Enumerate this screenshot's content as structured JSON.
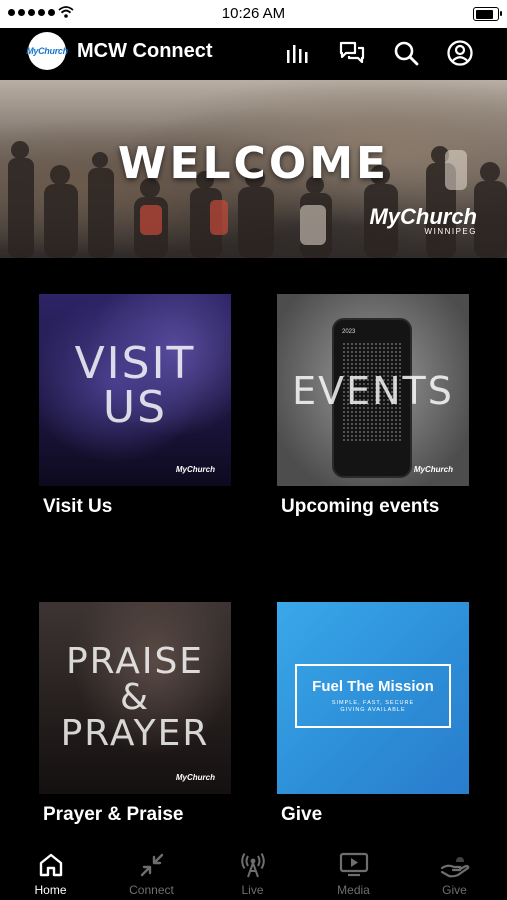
{
  "status_bar": {
    "time": "10:26 AM"
  },
  "header": {
    "logo_text": "MyChurch",
    "title": "MCW Connect",
    "icons": [
      "equalizer-icon",
      "chat-icon",
      "search-icon",
      "profile-icon"
    ]
  },
  "banner": {
    "headline": "WELCOME",
    "brand": "MyChurch",
    "brand_sub": "WINNIPEG"
  },
  "tiles": [
    {
      "label": "Visit Us",
      "overlay_lines": [
        "VISIT",
        "US"
      ],
      "brand": "MyChurch"
    },
    {
      "label": "Upcoming events",
      "overlay_lines": [
        "EVENTS"
      ],
      "brand": "MyChurch",
      "calendar_year": "2023"
    },
    {
      "label": "Prayer & Praise",
      "overlay_lines": [
        "PRAISE",
        "&",
        "PRAYER"
      ],
      "brand": "MyChurch"
    },
    {
      "label": "Give",
      "box_title": "Fuel The Mission",
      "box_sub_1": "SIMPLE, FAST, SECURE",
      "box_sub_2": "GIVING AVAILABLE"
    }
  ],
  "tabbar": {
    "active": "Home",
    "tabs": [
      {
        "label": "Home",
        "icon": "home-icon"
      },
      {
        "label": "Connect",
        "icon": "connect-icon"
      },
      {
        "label": "Live",
        "icon": "broadcast-icon"
      },
      {
        "label": "Media",
        "icon": "media-icon"
      },
      {
        "label": "Give",
        "icon": "give-icon"
      }
    ]
  },
  "colors": {
    "background": "#000000",
    "accent_blue": "#2f8fdc",
    "inactive_tab": "#6e6e6e"
  }
}
